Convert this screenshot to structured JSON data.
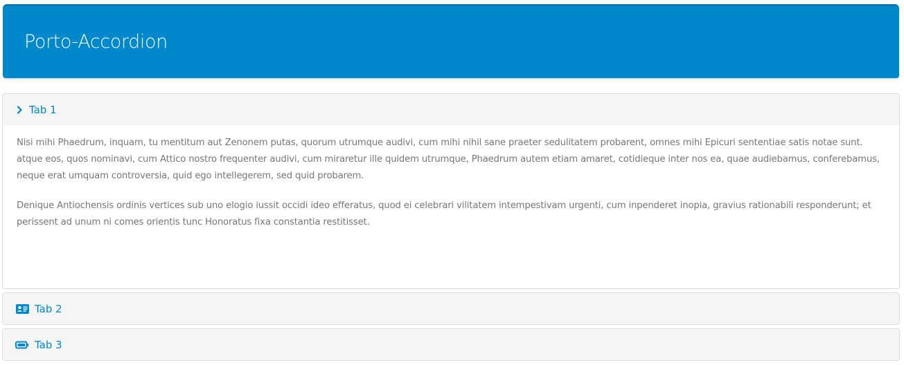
{
  "header": {
    "title": "Porto-Accordion"
  },
  "accordion": {
    "tabs": [
      {
        "label": "Tab 1",
        "icon": "chevron-right-icon",
        "expanded": true,
        "paragraphs": [
          "Nisi mihi Phaedrum, inquam, tu mentitum aut Zenonem putas, quorum utrumque audivi, cum mihi nihil sane praeter sedulitatem probarent, omnes mihi Epicuri sententiae satis notae sunt. atque eos, quos nominavi, cum Attico nostro frequenter audivi, cum miraretur ille quidem utrumque, Phaedrum autem etiam amaret, cotidieque inter nos ea, quae audiebamus, conferebamus, neque erat umquam controversia, quid ego intellegerem, sed quid probarem.",
          "Denique Antiochensis ordinis vertices sub uno elogio iussit occidi ideo efferatus, quod ei celebrari vilitatem intempestivam urgenti, cum inpenderet inopia, gravius rationabili responderunt; et perissent ad unum ni comes orientis tunc Honoratus fixa constantia restitisset."
        ]
      },
      {
        "label": "Tab 2",
        "icon": "id-card-icon",
        "expanded": false
      },
      {
        "label": "Tab 3",
        "icon": "battery-icon",
        "expanded": false
      }
    ]
  },
  "colors": {
    "header_bg": "#0088cc",
    "accent": "#0088cc",
    "panel_heading_bg": "#f5f5f5",
    "body_text": "#777777"
  }
}
